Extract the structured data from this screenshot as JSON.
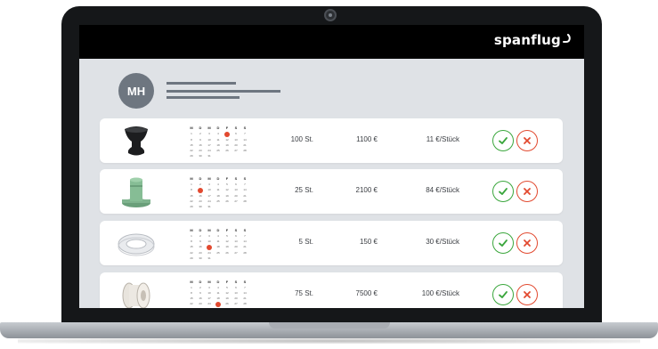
{
  "brand": {
    "name": "spanflug"
  },
  "user": {
    "initials": "MH"
  },
  "calendar_headers": [
    "M",
    "D",
    "M",
    "D",
    "F",
    "S",
    "S"
  ],
  "rows": [
    {
      "product": "black-rubber-foot",
      "quantity": "100 St.",
      "total": "1100 €",
      "unit_price": "11 €/Stück",
      "highlight_day": 5
    },
    {
      "product": "green-flange-part",
      "quantity": "25 St.",
      "total": "2100 €",
      "unit_price": "84 €/Stück",
      "highlight_day": 9
    },
    {
      "product": "white-ring-flange",
      "quantity": "5 St.",
      "total": "150 €",
      "unit_price": "30 €/Stück",
      "highlight_day": 17
    },
    {
      "product": "white-spool-part",
      "quantity": "75 St.",
      "total": "7500 €",
      "unit_price": "100 €/Stück",
      "highlight_day": 25
    }
  ],
  "colors": {
    "accept": "#3aa63c",
    "reject": "#e2492f",
    "avatar": "#6e7680",
    "screen_bg": "#dfe2e6"
  }
}
